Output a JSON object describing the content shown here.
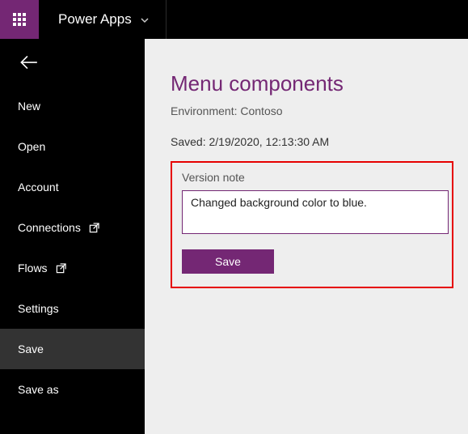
{
  "header": {
    "app_name": "Power Apps"
  },
  "sidebar": {
    "items": [
      {
        "label": "New"
      },
      {
        "label": "Open"
      },
      {
        "label": "Account"
      },
      {
        "label": "Connections"
      },
      {
        "label": "Flows"
      },
      {
        "label": "Settings"
      },
      {
        "label": "Save"
      },
      {
        "label": "Save as"
      }
    ]
  },
  "content": {
    "title": "Menu components",
    "environment_label": "Environment: ",
    "environment_value": "Contoso",
    "saved_label": "Saved: ",
    "saved_value": "2/19/2020, 12:13:30 AM",
    "version_note_label": "Version note",
    "version_note_value": "Changed background color to blue.",
    "save_button": "Save"
  }
}
